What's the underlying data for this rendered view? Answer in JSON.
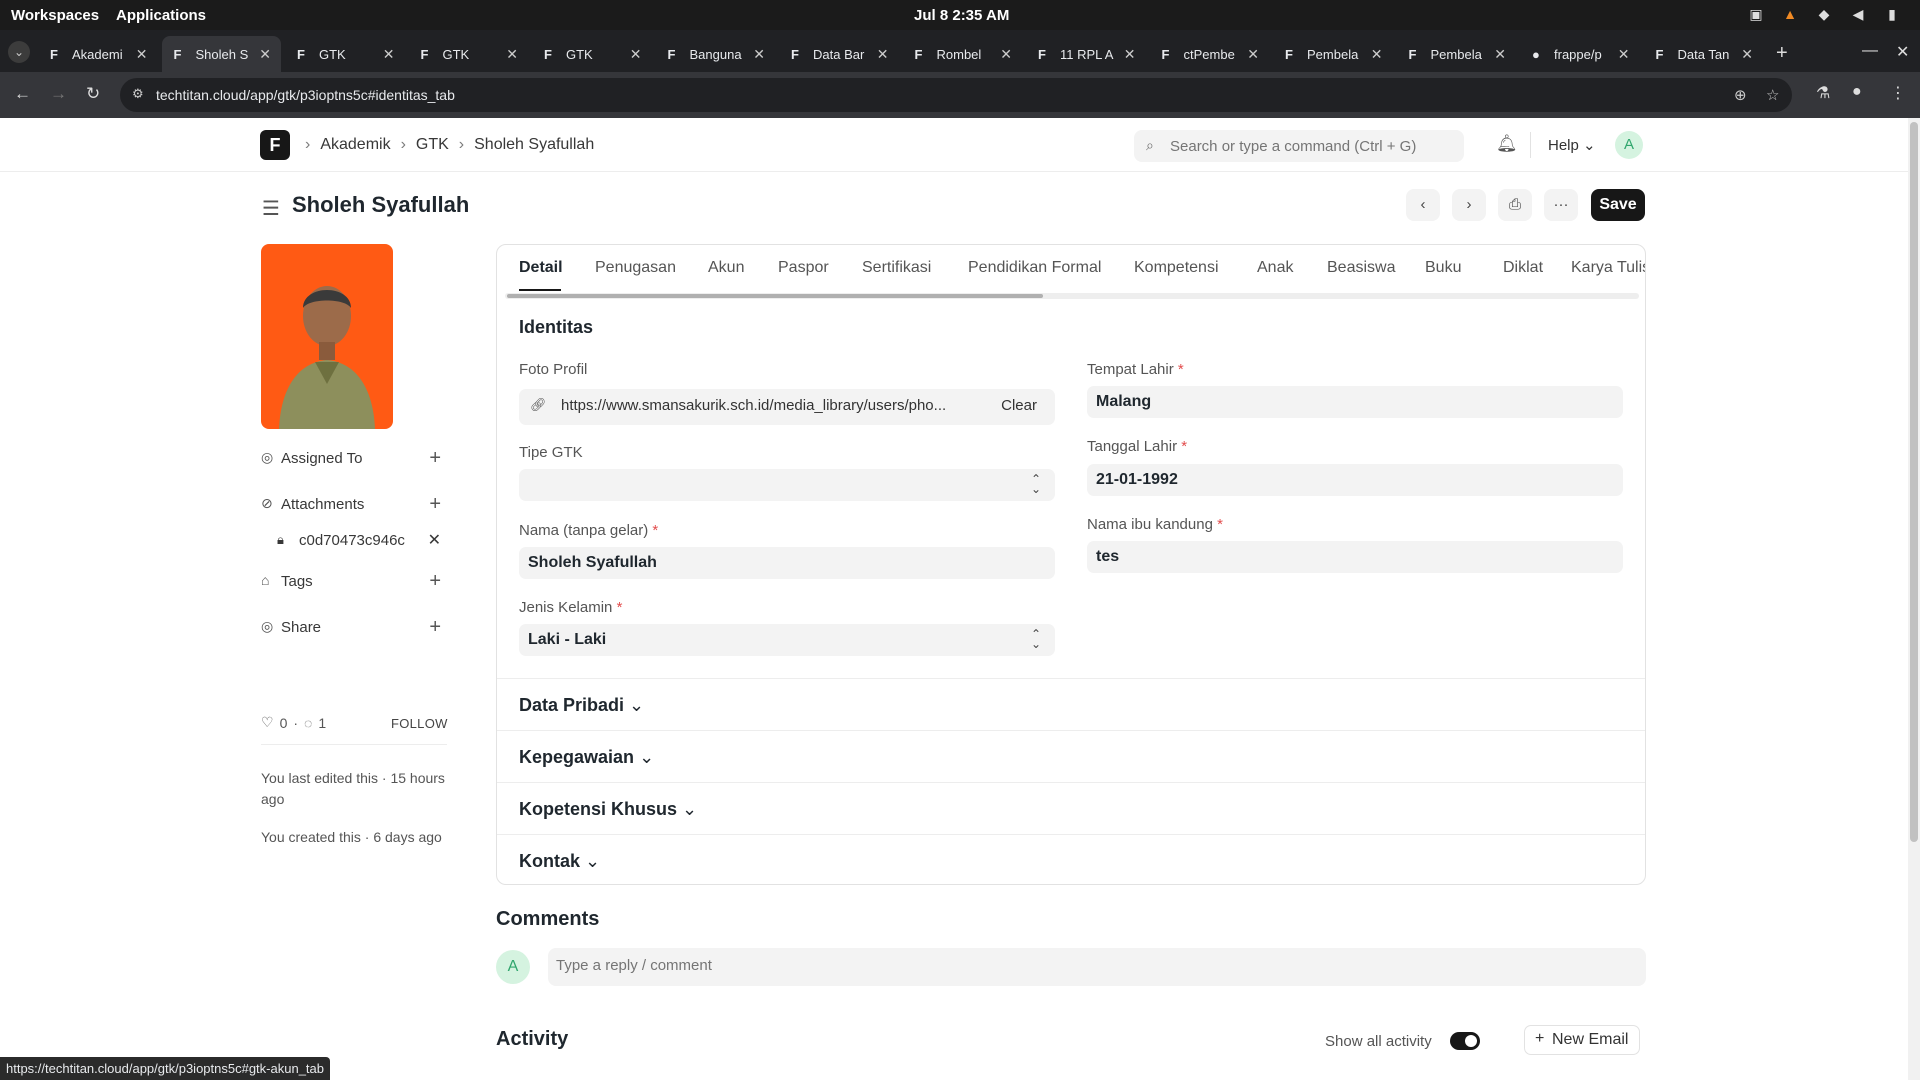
{
  "os": {
    "workspaces": "Workspaces",
    "applications": "Applications",
    "clock": "Jul 8  2:35 AM"
  },
  "tabs": [
    {
      "title": "Akademi",
      "icon": "frappe-icon",
      "active": false
    },
    {
      "title": "Sholeh S",
      "icon": "frappe-icon",
      "active": true
    },
    {
      "title": "GTK",
      "icon": "frappe-icon",
      "active": false
    },
    {
      "title": "GTK",
      "icon": "frappe-icon",
      "active": false
    },
    {
      "title": "GTK",
      "icon": "frappe-icon",
      "active": false
    },
    {
      "title": "Banguna",
      "icon": "frappe-icon",
      "active": false
    },
    {
      "title": "Data Bar",
      "icon": "frappe-icon",
      "active": false
    },
    {
      "title": "Rombel",
      "icon": "frappe-icon",
      "active": false
    },
    {
      "title": "11 RPL A",
      "icon": "frappe-icon",
      "active": false
    },
    {
      "title": "ctPembe",
      "icon": "frappe-icon",
      "active": false
    },
    {
      "title": "Pembela",
      "icon": "frappe-icon",
      "active": false
    },
    {
      "title": "Pembela",
      "icon": "frappe-icon",
      "active": false
    },
    {
      "title": "frappe/p",
      "icon": "github-icon",
      "active": false
    },
    {
      "title": "Data Tan",
      "icon": "frappe-icon",
      "active": false
    }
  ],
  "address": {
    "url": "techtitan.cloud/app/gtk/p3ioptns5c#identitas_tab"
  },
  "app": {
    "breadcrumbs": [
      "Akademik",
      "GTK",
      "Sholeh Syafullah"
    ],
    "search_placeholder": "Search or type a command (Ctrl + G)",
    "help_label": "Help",
    "avatar_letter": "A"
  },
  "page": {
    "title": "Sholeh Syafullah",
    "save_label": "Save"
  },
  "sidebar": {
    "assigned_to": "Assigned To",
    "attachments": "Attachments",
    "attachment_file": "c0d70473c946c",
    "tags": "Tags",
    "share": "Share",
    "likes": "0",
    "comments": "1",
    "follow": "FOLLOW",
    "last_edited": "You last edited this · 15 hours ago",
    "created": "You created this · 6 days ago"
  },
  "form_tabs": [
    "Detail",
    "Penugasan",
    "Akun",
    "Paspor",
    "Sertifikasi",
    "Pendidikan Formal",
    "Kompetensi",
    "Anak",
    "Beasiswa",
    "Buku",
    "Diklat",
    "Karya Tulis"
  ],
  "identitas": {
    "section_title": "Identitas",
    "foto_profil_label": "Foto Profil",
    "foto_profil_value": "https://www.smansakurik.sch.id/media_library/users/pho...",
    "clear_label": "Clear",
    "tipe_gtk_label": "Tipe GTK",
    "tipe_gtk_value": "",
    "nama_label": "Nama (tanpa gelar)",
    "nama_value": "Sholeh Syafullah",
    "jenis_kelamin_label": "Jenis Kelamin",
    "jenis_kelamin_value": "Laki - Laki",
    "tempat_lahir_label": "Tempat Lahir",
    "tempat_lahir_value": "Malang",
    "tanggal_lahir_label": "Tanggal Lahir",
    "tanggal_lahir_value": "21-01-1992",
    "nama_ibu_label": "Nama ibu kandung",
    "nama_ibu_value": "tes",
    "required_mark": "*"
  },
  "sections": [
    "Data Pribadi",
    "Kepegawaian",
    "Kopetensi Khusus",
    "Kontak"
  ],
  "comments": {
    "title": "Comments",
    "avatar_letter": "A",
    "placeholder": "Type a reply / comment"
  },
  "activity": {
    "title": "Activity",
    "show_all_label": "Show all activity",
    "show_all_on": true,
    "new_email_label": "New Email"
  },
  "status_bar": {
    "hover_url": "https://techtitan.cloud/app/gtk/p3ioptns5c#gtk-akun_tab"
  },
  "colors": {
    "accent": "#171717",
    "required": "#e24c4c",
    "photo_background": "#ff5a14",
    "avatar_bg": "#d5f3e0",
    "avatar_fg": "#30a66d"
  }
}
